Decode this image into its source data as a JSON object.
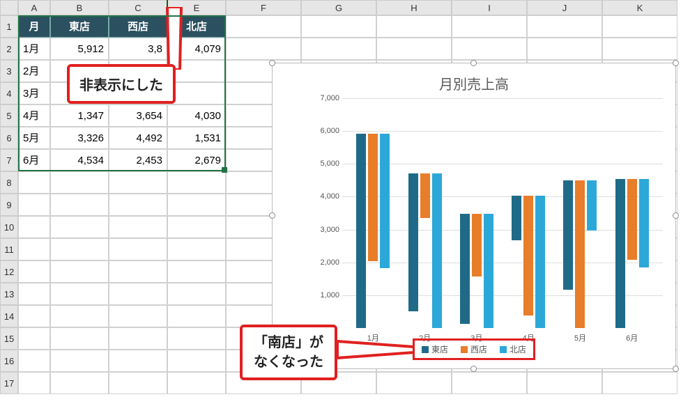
{
  "columns": [
    "A",
    "B",
    "C",
    "E",
    "F",
    "G",
    "H",
    "I",
    "J",
    "K"
  ],
  "table": {
    "headers": [
      "月",
      "東店",
      "西店",
      "北店"
    ],
    "rows": [
      {
        "m": "1月",
        "v": [
          "5,912",
          "3,8",
          "4,079"
        ]
      },
      {
        "m": "2月",
        "v": [
          "",
          "",
          ""
        ]
      },
      {
        "m": "3月",
        "v": [
          "",
          "",
          ""
        ]
      },
      {
        "m": "4月",
        "v": [
          "1,347",
          "3,654",
          "4,030"
        ]
      },
      {
        "m": "5月",
        "v": [
          "3,326",
          "4,492",
          "1,531"
        ]
      },
      {
        "m": "6月",
        "v": [
          "4,534",
          "2,453",
          "2,679"
        ]
      }
    ]
  },
  "callout1": "非表示にした",
  "callout2_line1": "「南店」が",
  "callout2_line2": "なくなった",
  "chart_data": {
    "type": "bar",
    "title": "月別売上高",
    "ylabel": "",
    "xlabel": "",
    "ylim": [
      0,
      7000
    ],
    "yticks": [
      1000,
      2000,
      3000,
      4000,
      5000,
      6000,
      7000
    ],
    "categories": [
      "1月",
      "2月",
      "3月",
      "4月",
      "5月",
      "6月"
    ],
    "series": [
      {
        "name": "東店",
        "values": [
          5912,
          4220,
          3360,
          1347,
          3326,
          4534
        ]
      },
      {
        "name": "西店",
        "values": [
          3880,
          1370,
          1900,
          3654,
          4492,
          2453
        ]
      },
      {
        "name": "北店",
        "values": [
          4079,
          4720,
          3480,
          4030,
          1531,
          2679
        ]
      }
    ],
    "legend": [
      "東店",
      "西店",
      "北店"
    ]
  }
}
